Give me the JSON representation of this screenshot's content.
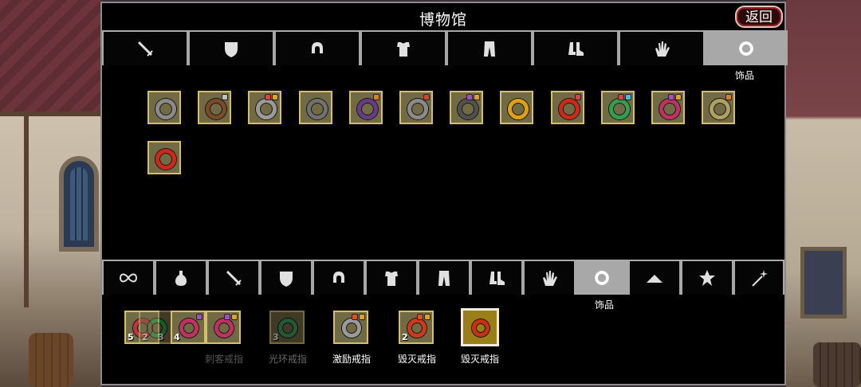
{
  "header": {
    "title": "博物馆",
    "back_label": "返回"
  },
  "museum_tabs": [
    {
      "icon": "sword-icon",
      "active": false
    },
    {
      "icon": "shield-icon",
      "active": false
    },
    {
      "icon": "helmet-icon",
      "active": false
    },
    {
      "icon": "armor-icon",
      "active": false
    },
    {
      "icon": "pants-icon",
      "active": false
    },
    {
      "icon": "boots-icon",
      "active": false
    },
    {
      "icon": "gloves-icon",
      "active": false
    },
    {
      "icon": "ring-icon",
      "active": true,
      "label": "饰品"
    }
  ],
  "museum_items": [
    {
      "ring": "#8a8a8a",
      "gems": []
    },
    {
      "ring": "#7a4a2a",
      "gems": [
        "#c0c0c0"
      ]
    },
    {
      "ring": "#9a9a9a",
      "gems": [
        "#e04040",
        "#e0a020"
      ]
    },
    {
      "ring": "#707070",
      "gems": []
    },
    {
      "ring": "#6a3a8a",
      "gems": [
        "#e08020"
      ]
    },
    {
      "ring": "#8a8a8a",
      "gems": [
        "#e04030"
      ]
    },
    {
      "ring": "#505050",
      "gems": [
        "#a050c0",
        "#e0a020"
      ]
    },
    {
      "ring": "#e0a010",
      "gems": []
    },
    {
      "ring": "#d02818",
      "gems": [
        "#e04040"
      ]
    },
    {
      "ring": "#30a050",
      "gems": [
        "#e04040",
        "#40c0e0"
      ]
    },
    {
      "ring": "#c03060",
      "gems": [
        "#a050c0",
        "#e0a020"
      ]
    },
    {
      "ring": "#b0a060",
      "gems": [
        "#e08020"
      ]
    },
    {
      "ring": "#d02818",
      "gems": []
    }
  ],
  "inventory_tabs": [
    {
      "icon": "infinity-icon",
      "active": false
    },
    {
      "icon": "potion-icon",
      "active": false
    },
    {
      "icon": "sword-icon",
      "active": false
    },
    {
      "icon": "shield-icon",
      "active": false
    },
    {
      "icon": "helmet-icon",
      "active": false
    },
    {
      "icon": "armor-icon",
      "active": false
    },
    {
      "icon": "pants-icon",
      "active": false
    },
    {
      "icon": "boots-icon",
      "active": false
    },
    {
      "icon": "gloves-icon",
      "active": false
    },
    {
      "icon": "ring-icon",
      "active": true,
      "label": "饰品"
    },
    {
      "icon": "hat-icon",
      "active": false
    },
    {
      "icon": "star-icon",
      "active": false
    },
    {
      "icon": "wand-icon",
      "active": false
    }
  ],
  "inventory": {
    "stack_counts": [
      "5",
      "2",
      "3",
      "4"
    ],
    "groups": [
      {
        "label": "刺客戒指",
        "label_color": "#555555"
      },
      {
        "label": "光环戒指",
        "label_color": "#666666",
        "count": "3"
      },
      {
        "label": "激励戒指",
        "label_color": "#ffffff"
      },
      {
        "label": "毁灭戒指",
        "label_color": "#ffffff",
        "count": "2"
      },
      {
        "label": "毁灭戒指",
        "label_color": "#ffffff",
        "selected": true
      }
    ]
  }
}
